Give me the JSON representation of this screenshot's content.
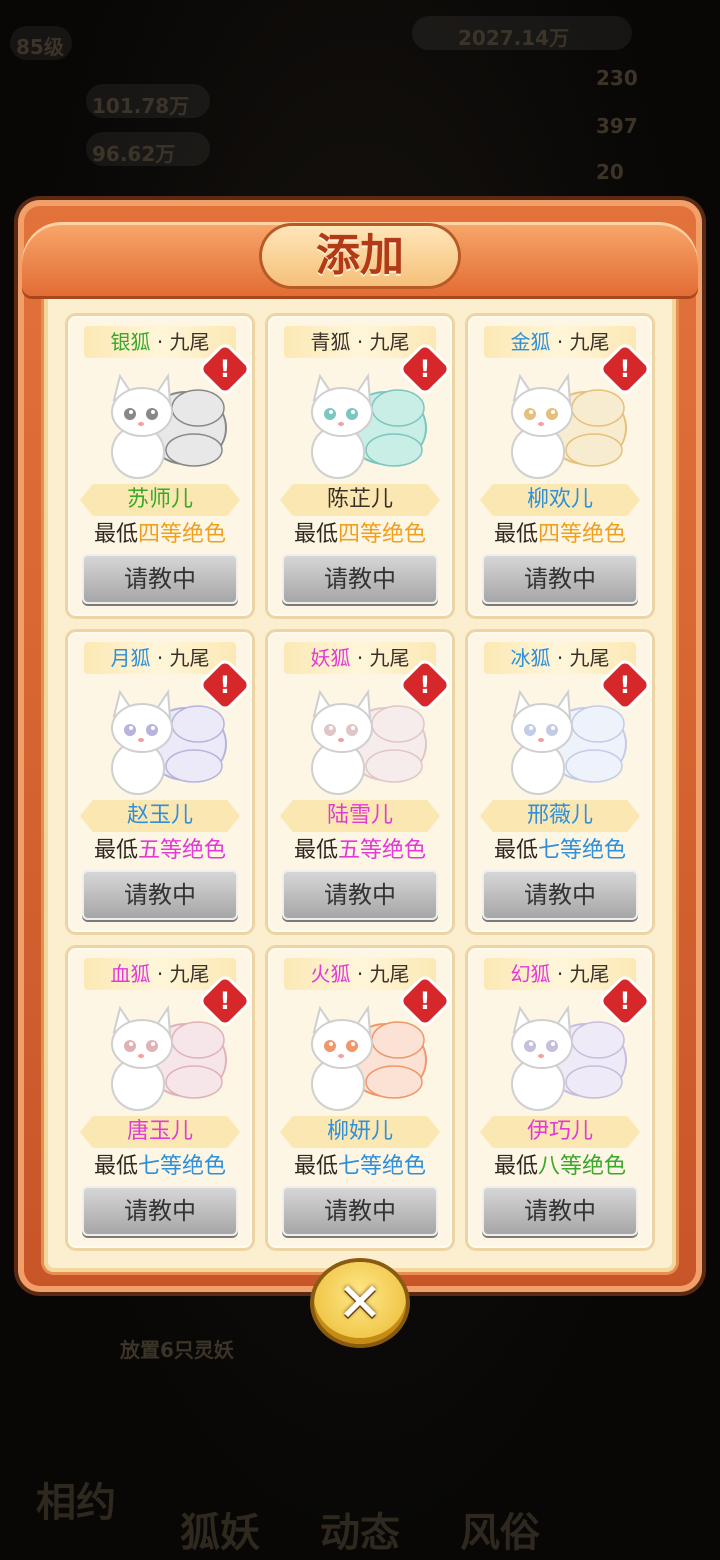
{
  "hud": {
    "level": "85级",
    "coins": "2027.14万",
    "stat1_value": "101.78万",
    "stat2_value": "96.62万",
    "right1": "230",
    "right2": "397",
    "right3": "20",
    "bottom_hint": "放置6只灵妖",
    "bottom_tabs": [
      "相约",
      "狐妖",
      "动态",
      "风俗"
    ]
  },
  "title": "添加",
  "colors": {
    "green": "#3aa82a",
    "blue": "#2f8fd8",
    "magenta": "#e23ad6",
    "orange": "#f0a020"
  },
  "cards": [
    {
      "kind": "银狐",
      "tail": "九尾",
      "name": "苏师儿",
      "req_prefix": "最低",
      "grade": "四等绝色",
      "kind_color": "#3aa82a",
      "name_color": "#3aa82a",
      "grade_color": "#f0a020",
      "btn": "请教中",
      "palette": [
        "#e8e8e8",
        "#888"
      ]
    },
    {
      "kind": "青狐",
      "tail": "九尾",
      "name": "陈芷儿",
      "req_prefix": "最低",
      "grade": "四等绝色",
      "kind_color": "#3a3128",
      "name_color": "#3a3128",
      "grade_color": "#f0a020",
      "btn": "请教中",
      "palette": [
        "#c8eee6",
        "#7cc6c0"
      ]
    },
    {
      "kind": "金狐",
      "tail": "九尾",
      "name": "柳欢儿",
      "req_prefix": "最低",
      "grade": "四等绝色",
      "kind_color": "#2f8fd8",
      "name_color": "#2f8fd8",
      "grade_color": "#f0a020",
      "btn": "请教中",
      "palette": [
        "#f8ecd0",
        "#e6c07a"
      ]
    },
    {
      "kind": "月狐",
      "tail": "九尾",
      "name": "赵玉儿",
      "req_prefix": "最低",
      "grade": "五等绝色",
      "kind_color": "#2f8fd8",
      "name_color": "#2f8fd8",
      "grade_color": "#e23ad6",
      "btn": "请教中",
      "palette": [
        "#eceaf8",
        "#b6b4dc"
      ]
    },
    {
      "kind": "妖狐",
      "tail": "九尾",
      "name": "陆雪儿",
      "req_prefix": "最低",
      "grade": "五等绝色",
      "kind_color": "#e23ad6",
      "name_color": "#e23ad6",
      "grade_color": "#e23ad6",
      "btn": "请教中",
      "palette": [
        "#f6ecec",
        "#e0c6c6"
      ]
    },
    {
      "kind": "冰狐",
      "tail": "九尾",
      "name": "邢薇儿",
      "req_prefix": "最低",
      "grade": "七等绝色",
      "kind_color": "#2f8fd8",
      "name_color": "#2f8fd8",
      "grade_color": "#2f8fd8",
      "btn": "请教中",
      "palette": [
        "#eef2fa",
        "#c2cce6"
      ]
    },
    {
      "kind": "血狐",
      "tail": "九尾",
      "name": "唐玉儿",
      "req_prefix": "最低",
      "grade": "七等绝色",
      "kind_color": "#e23ad6",
      "name_color": "#e23ad6",
      "grade_color": "#2f8fd8",
      "btn": "请教中",
      "palette": [
        "#f6e6ea",
        "#e0b2b8"
      ]
    },
    {
      "kind": "火狐",
      "tail": "九尾",
      "name": "柳妍儿",
      "req_prefix": "最低",
      "grade": "七等绝色",
      "kind_color": "#e23ad6",
      "name_color": "#2f8fd8",
      "grade_color": "#2f8fd8",
      "btn": "请教中",
      "palette": [
        "#fbe2d4",
        "#f0966a"
      ]
    },
    {
      "kind": "幻狐",
      "tail": "九尾",
      "name": "伊巧儿",
      "req_prefix": "最低",
      "grade": "八等绝色",
      "kind_color": "#e23ad6",
      "name_color": "#e23ad6",
      "grade_color": "#3aa82a",
      "btn": "请教中",
      "palette": [
        "#efeaf8",
        "#c6bedc"
      ]
    }
  ],
  "close_label": "✕"
}
